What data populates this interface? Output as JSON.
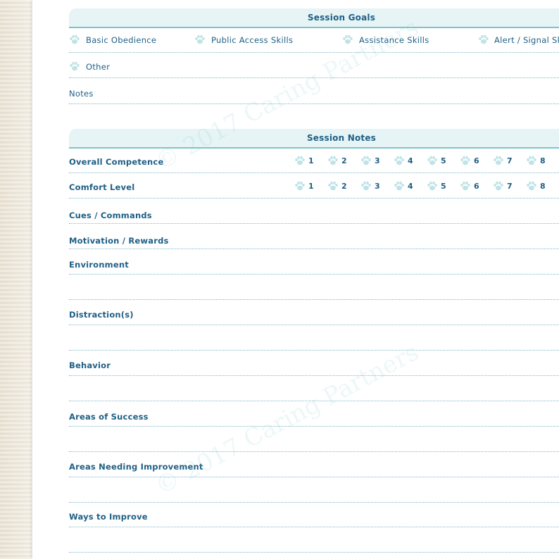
{
  "session_goals": {
    "title": "Session Goals",
    "options": [
      "Basic Obedience",
      "Public Access Skills",
      "Assistance Skills",
      "Alert / Signal Sk",
      "Other"
    ],
    "notes_label": "Notes"
  },
  "session_notes": {
    "title": "Session Notes",
    "ratings": [
      {
        "label": "Overall Competence",
        "scale": [
          "1",
          "2",
          "3",
          "4",
          "5",
          "6",
          "7",
          "8"
        ]
      },
      {
        "label": "Comfort Level",
        "scale": [
          "1",
          "2",
          "3",
          "4",
          "5",
          "6",
          "7",
          "8"
        ]
      }
    ],
    "fields": [
      "Cues / Commands",
      "Motivation / Rewards",
      "Environment",
      "Distraction(s)",
      "Behavior",
      "Areas of Success",
      "Areas Needing Improvement",
      "Ways to Improve"
    ]
  },
  "watermark": "© 2017 Caring Partners",
  "colors": {
    "accent": "#1f5f86",
    "paw": "#bfe3e6",
    "banner": "#e6f4f5",
    "rule": "#7fc3c8"
  }
}
